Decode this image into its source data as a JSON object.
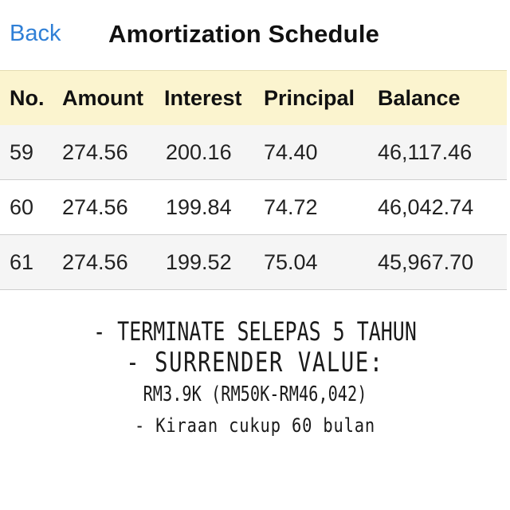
{
  "navbar": {
    "back_label": "Back",
    "title": "Amortization Schedule"
  },
  "table": {
    "columns": [
      "No.",
      "Amount",
      "Interest",
      "Principal",
      "Balance"
    ],
    "rows": [
      {
        "no": "59",
        "amount": "274.56",
        "interest": "200.16",
        "principal": "74.40",
        "balance": "46,117.46"
      },
      {
        "no": "60",
        "amount": "274.56",
        "interest": "199.84",
        "principal": "74.72",
        "balance": "46,042.74"
      },
      {
        "no": "61",
        "amount": "274.56",
        "interest": "199.52",
        "principal": "75.04",
        "balance": "45,967.70"
      }
    ]
  },
  "notes": {
    "line1": "- TERMINATE SELEPAS 5 TAHUN",
    "line2": "- SURRENDER VALUE:",
    "line3": "RM3.9K (RM50K-RM46,042)",
    "line4": "- Kiraan cukup 60 bulan"
  },
  "colors": {
    "accent": "#2f7fd6",
    "header_bg": "#fbf4cf",
    "row_shade": "#f5f5f5"
  }
}
